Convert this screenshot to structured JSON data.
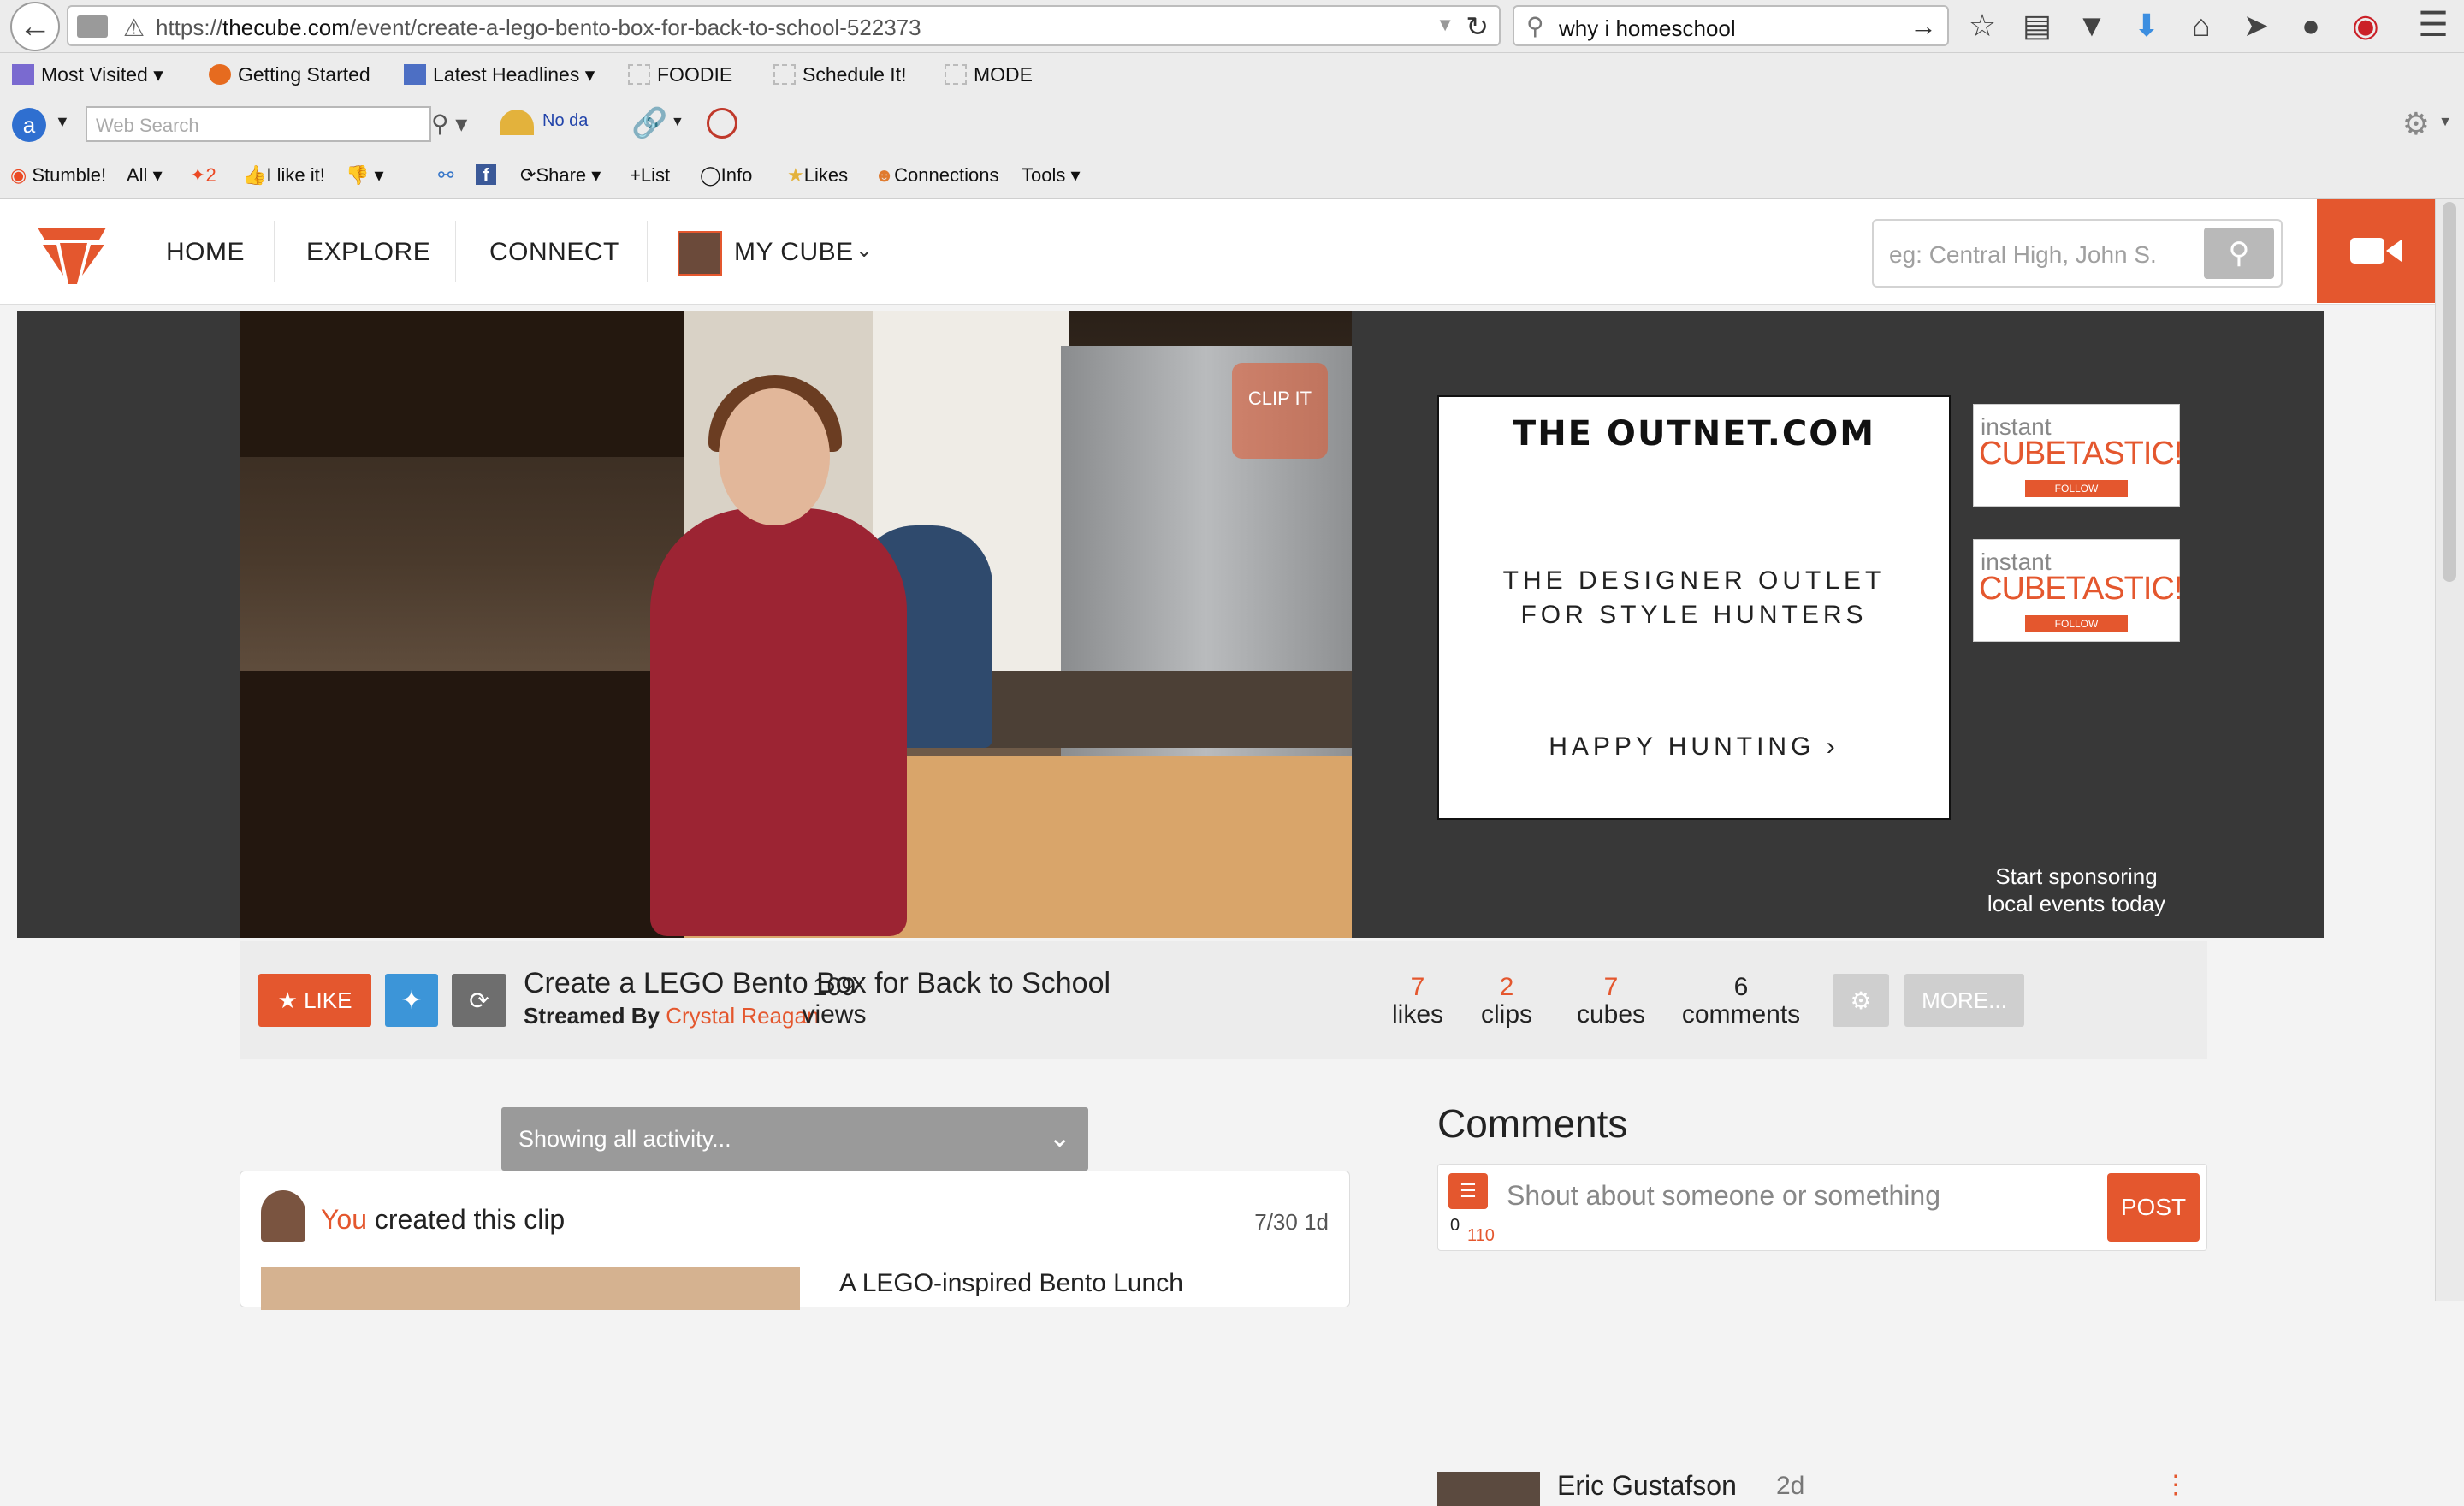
{
  "browser": {
    "url_prefix": "https://",
    "url_domain": "thecube.com",
    "url_path": "/event/create-a-lego-bento-box-for-back-to-school-522373",
    "search_query": "why i homeschool"
  },
  "bookmarks": [
    {
      "label": "Most Visited",
      "icon": "folder-icon"
    },
    {
      "label": "Getting Started",
      "icon": "firefox-icon"
    },
    {
      "label": "Latest Headlines",
      "icon": "rss-icon"
    },
    {
      "label": "FOODIE",
      "icon": "page-icon"
    },
    {
      "label": "Schedule It!",
      "icon": "page-icon"
    },
    {
      "label": "MODE",
      "icon": "page-icon"
    }
  ],
  "toolbar3": {
    "web_search_placeholder": "Web Search",
    "weather_text": "No da"
  },
  "stumble": {
    "stumble": "Stumble!",
    "all": "All",
    "count": "2",
    "like": "I like it!",
    "share": "Share",
    "list": "List",
    "info": "Info",
    "likes": "Likes",
    "connections": "Connections",
    "tools": "Tools"
  },
  "site": {
    "nav": {
      "home": "HOME",
      "explore": "EXPLORE",
      "connect": "CONNECT",
      "my_cube": "MY CUBE"
    },
    "search_placeholder": "eg: Central High, John S.",
    "accent": "#e4572e"
  },
  "video": {
    "clip_label": "CLIP IT"
  },
  "ads": {
    "outnet": {
      "brand": "THE OUTNET.COM",
      "line1": "THE DESIGNER OUTLET",
      "line2": "FOR STYLE HUNTERS",
      "cta": "HAPPY HUNTING"
    },
    "cubetastic": {
      "instant": "instant",
      "brand": "CUBETASTIC!",
      "follow": "FOLLOW"
    },
    "sponsor_line1": "Start sponsoring",
    "sponsor_line2": "local events today"
  },
  "event": {
    "like_label": "LIKE",
    "title": "Create a LEGO Bento Box for Back to School",
    "streamed_by_label": "Streamed By",
    "streamer": "Crystal Reagan",
    "stats": [
      {
        "value": "109",
        "label": "views"
      },
      {
        "value": "7",
        "label": "likes"
      },
      {
        "value": "2",
        "label": "clips"
      },
      {
        "value": "7",
        "label": "cubes"
      },
      {
        "value": "6",
        "label": "comments"
      }
    ],
    "more_label": "MORE..."
  },
  "activity": {
    "filter": "Showing all activity...",
    "item": {
      "actor": "You",
      "action": "created this clip",
      "date": "7/30 1d",
      "clip_title": "A LEGO-inspired Bento Lunch"
    }
  },
  "comments": {
    "heading": "Comments",
    "placeholder": "Shout about someone or something",
    "count_zero": "0",
    "count_max": "110",
    "post_label": "POST",
    "first": {
      "name": "Eric Gustafson",
      "time": "2d"
    }
  }
}
